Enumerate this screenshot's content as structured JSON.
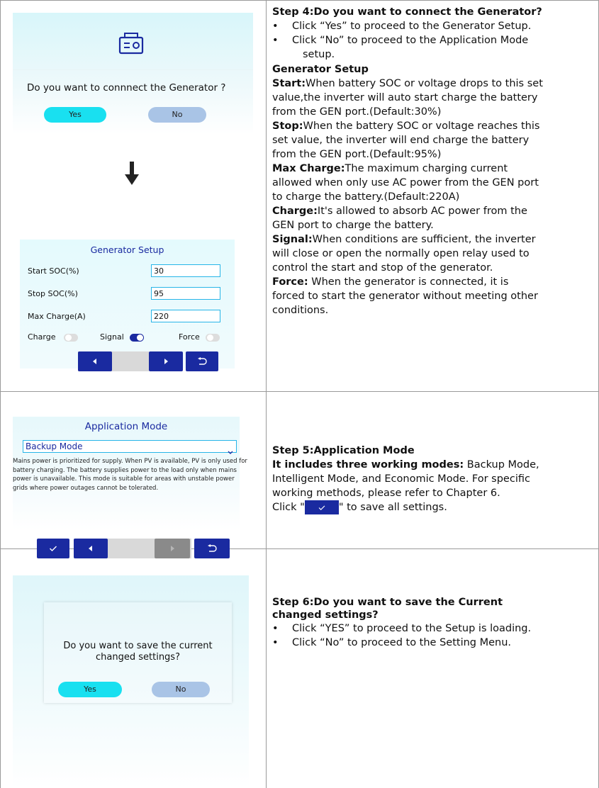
{
  "step4": {
    "dialog_question": "Do you want to connnect  the Generator ?",
    "yes_label": "Yes",
    "no_label": "No",
    "title": "Step 4:Do you want to connect the Generator?",
    "bullet1": "Click “Yes” to proceed to the Generator Setup.",
    "bullet2a": "Click “No” to proceed to the Application Mode",
    "bullet2b": "setup.",
    "setup_heading": "Generator Setup",
    "start_label": "Start:",
    "start_text": [
      "When battery SOC or voltage drops to this set",
      "value,the inverter will auto start charge the battery",
      "from the GEN port.(Default:30%)"
    ],
    "stop_label": "Stop:",
    "stop_text": [
      "When the battery SOC or voltage reaches this",
      "set value, the inverter will end charge the battery",
      "from the GEN port.(Default:95%)"
    ],
    "maxcharge_label": "Max Charge:",
    "maxcharge_text": [
      "The maximum charging current",
      "allowed when only use AC power from the GEN port",
      "to charge the battery.(Default:220A)"
    ],
    "charge_label": "Charge:",
    "charge_text": [
      "It's allowed to absorb AC power from the",
      "GEN port to charge the battery."
    ],
    "signal_label": "Signal:",
    "signal_text": [
      "When conditions are sufficient, the inverter",
      "will close or open the normally open relay used to",
      "control the start and stop of the generator."
    ],
    "force_label": "Force:",
    "force_text": [
      " When the generator is connected, it is",
      "forced to start the generator without meeting other",
      "conditions."
    ]
  },
  "gen_setup_screen": {
    "title": "Generator Setup",
    "start_soc_label": "Start SOC(%)",
    "start_soc_value": "30",
    "stop_soc_label": "Stop SOC(%)",
    "stop_soc_value": "95",
    "max_charge_label": "Max Charge(A)",
    "max_charge_value": "220",
    "charge_toggle_label": "Charge",
    "signal_toggle_label": "Signal",
    "force_toggle_label": "Force",
    "charge_on": false,
    "signal_on": true,
    "force_on": false
  },
  "app_mode_screen": {
    "title": "Application Mode",
    "selected_mode": "Backup Mode",
    "description": [
      "Mains power is prioritized for supply. When PV is available, PV is only used for",
      " battery charging. The battery supplies power to the load only when mains",
      "power is unavailable. This mode is suitable for areas with unstable power",
      "grids where power outages cannot be tolerated."
    ]
  },
  "step5": {
    "title": "Step 5:Application Mode",
    "modes_label": "It includes three working modes:",
    "modes_text": " Backup Mode,",
    "line2": "Intelligent Mode, and Economic Mode. For specific",
    "line3": "working methods, please refer to Chapter 6.",
    "click_prefix": "Click \"",
    "click_suffix": "\" to save all settings."
  },
  "step6_dialog": {
    "question_line1": "Do you want to save the current",
    "question_line2": "changed settings?",
    "yes_label": "Yes",
    "no_label": "No"
  },
  "step6": {
    "title_line1": "Step 6:Do you want to save the Current",
    "title_line2": "changed settings?",
    "bullet1": "Click “YES” to proceed to the Setup is loading.",
    "bullet2": "Click “No” to proceed to the Setting Menu."
  },
  "colors": {
    "nav_button": "#1a2aa0",
    "yes_button": "#19e0f0",
    "no_button": "#a9c4e6",
    "field_border": "#27b5e8",
    "title_blue": "#1a2aa0"
  }
}
